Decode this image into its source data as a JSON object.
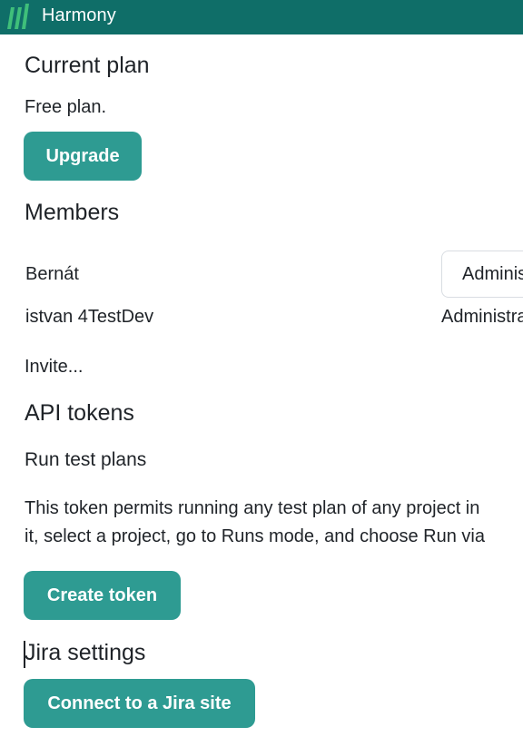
{
  "app": {
    "title": "Harmony",
    "brand_color": "#0f6e68",
    "accent_color": "#2e9b92",
    "logo_icon": "harmony-logo-icon"
  },
  "current_plan": {
    "heading": "Current plan",
    "description": "Free plan.",
    "upgrade_label": "Upgrade"
  },
  "members": {
    "heading": "Members",
    "rows": [
      {
        "name": "Bernát",
        "role": "Administrator"
      },
      {
        "name": "istvan 4TestDev",
        "role": "Administrator"
      }
    ],
    "invite_label": "Invite..."
  },
  "api_tokens": {
    "heading": "API tokens",
    "subheading": "Run test plans",
    "description_line1": "This token permits running any test plan of any project in",
    "description_line2": "it, select a project, go to Runs mode, and choose Run via",
    "create_label": "Create token"
  },
  "jira": {
    "heading": "Jira settings",
    "connect_label": "Connect to a Jira site"
  }
}
